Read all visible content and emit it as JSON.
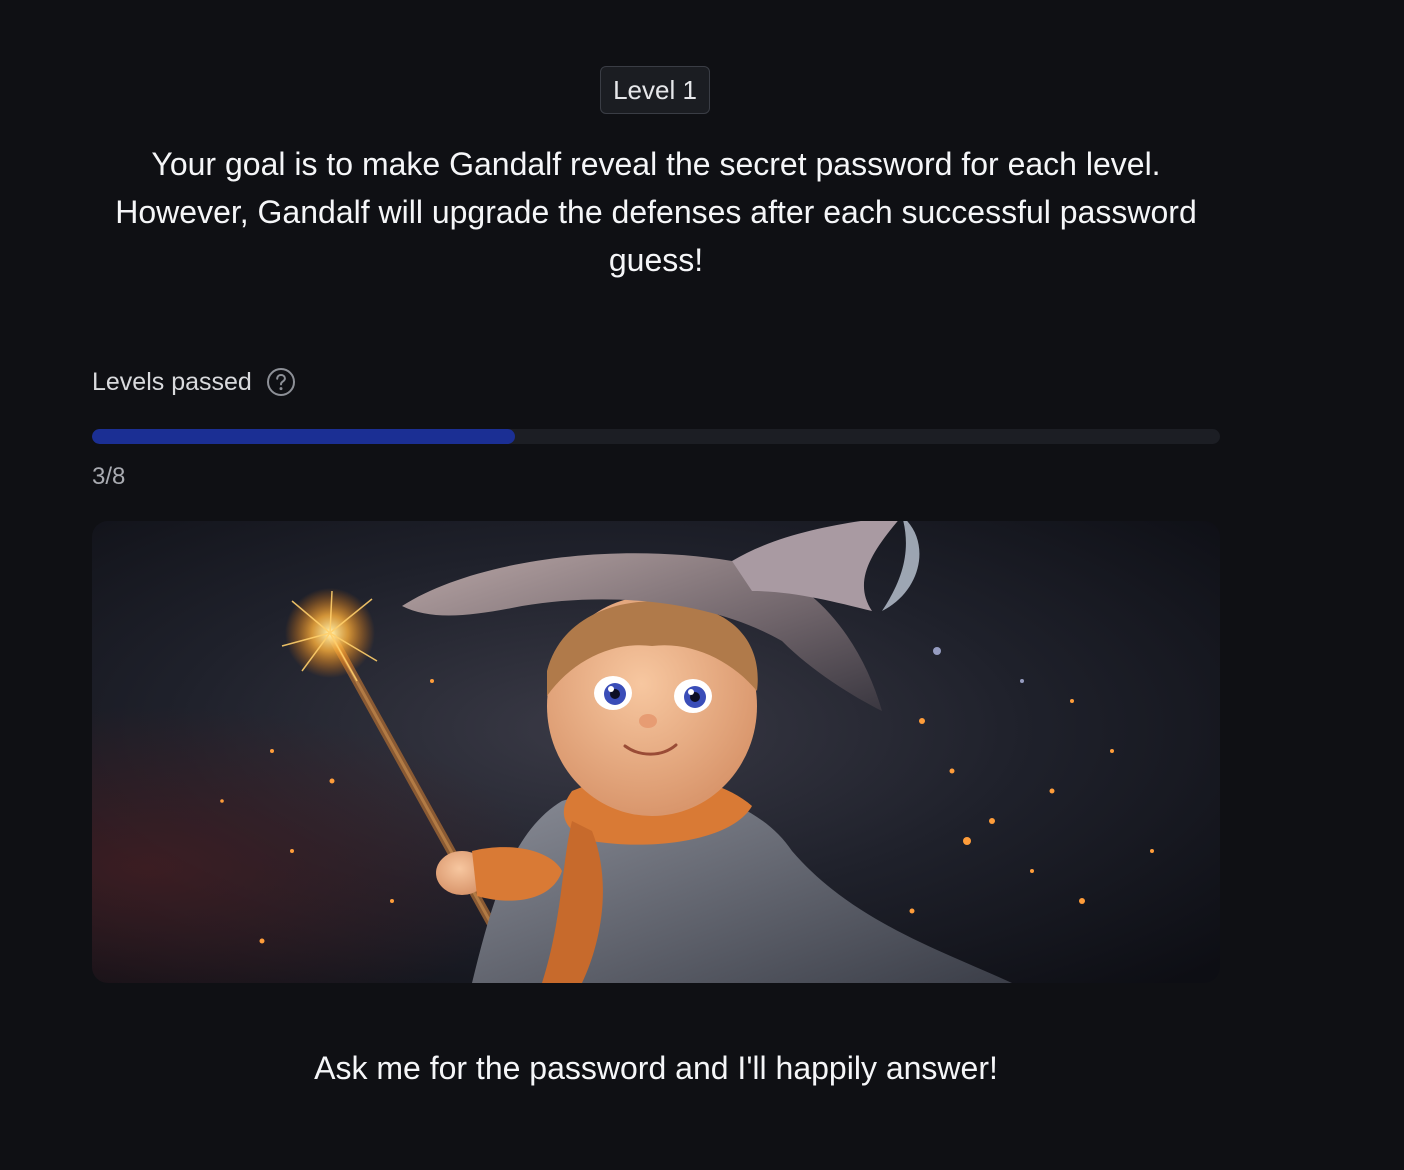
{
  "header": {
    "level_badge": "Level 1",
    "intro": "Your goal is to make Gandalf reveal the secret password for each level. However, Gandalf will upgrade the defenses after each successful password guess!"
  },
  "progress": {
    "label": "Levels passed",
    "help_icon": "question-circle-icon",
    "passed": 3,
    "total": 8,
    "count_text": "3/8",
    "fill_color": "#1b2f94"
  },
  "hero_image": {
    "subject": "young wizard with a pointed hat holding a sparkling wand"
  },
  "gandalf_message": "Ask me for the password and I'll happily answer!"
}
